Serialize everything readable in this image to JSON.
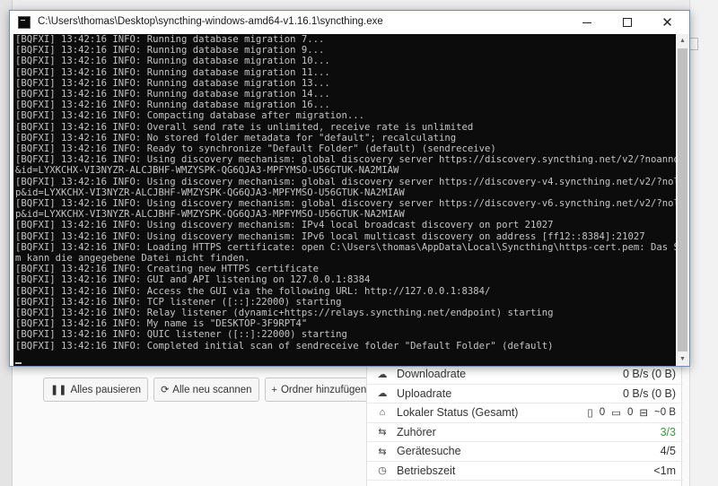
{
  "window": {
    "title": "C:\\Users\\thomas\\Desktop\\syncthing-windows-amd64-v1.16.1\\syncthing.exe",
    "controls": {
      "minimize": "—",
      "maximize": "☐",
      "close": "✕"
    }
  },
  "console": {
    "lines": [
      "[BQFXI] 13:42:16 INFO: Running database migration 7...",
      "[BQFXI] 13:42:16 INFO: Running database migration 9...",
      "[BQFXI] 13:42:16 INFO: Running database migration 10...",
      "[BQFXI] 13:42:16 INFO: Running database migration 11...",
      "[BQFXI] 13:42:16 INFO: Running database migration 13...",
      "[BQFXI] 13:42:16 INFO: Running database migration 14...",
      "[BQFXI] 13:42:16 INFO: Running database migration 16...",
      "[BQFXI] 13:42:16 INFO: Compacting database after migration...",
      "[BQFXI] 13:42:16 INFO: Overall send rate is unlimited, receive rate is unlimited",
      "[BQFXI] 13:42:16 INFO: No stored folder metadata for \"default\"; recalculating",
      "[BQFXI] 13:42:16 INFO: Ready to synchronize \"Default Folder\" (default) (sendreceive)",
      "[BQFXI] 13:42:16 INFO: Using discovery mechanism: global discovery server https://discovery.syncthing.net/v2/?noannounce",
      "&id=LYXKCHX-VI3NYZR-ALCJBHF-WMZYSPK-QG6QJA3-MPFYMSO-U56GTUK-NA2MIAW",
      "[BQFXI] 13:42:16 INFO: Using discovery mechanism: global discovery server https://discovery-v4.syncthing.net/v2/?nolooku",
      "p&id=LYXKCHX-VI3NYZR-ALCJBHF-WMZYSPK-QG6QJA3-MPFYMSO-U56GTUK-NA2MIAW",
      "[BQFXI] 13:42:16 INFO: Using discovery mechanism: global discovery server https://discovery-v6.syncthing.net/v2/?nolooku",
      "p&id=LYXKCHX-VI3NYZR-ALCJBHF-WMZYSPK-QG6QJA3-MPFYMSO-U56GTUK-NA2MIAW",
      "[BQFXI] 13:42:16 INFO: Using discovery mechanism: IPv4 local broadcast discovery on port 21027",
      "[BQFXI] 13:42:16 INFO: Using discovery mechanism: IPv6 local multicast discovery on address [ff12::8384]:21027",
      "[BQFXI] 13:42:16 INFO: Loading HTTPS certificate: open C:\\Users\\thomas\\AppData\\Local\\Syncthing\\https-cert.pem: Das Syste",
      "m kann die angegebene Datei nicht finden.",
      "[BQFXI] 13:42:16 INFO: Creating new HTTPS certificate",
      "[BQFXI] 13:42:16 INFO: GUI and API listening on 127.0.0.1:8384",
      "[BQFXI] 13:42:16 INFO: Access the GUI via the following URL: http://127.0.0.1:8384/",
      "[BQFXI] 13:42:16 INFO: TCP listener ([::]:22000) starting",
      "[BQFXI] 13:42:16 INFO: Relay listener (dynamic+https://relays.syncthing.net/endpoint) starting",
      "[BQFXI] 13:42:16 INFO: My name is \"DESKTOP-3F9RPT4\"",
      "[BQFXI] 13:42:16 INFO: QUIC listener ([::]:22000) starting",
      "[BQFXI] 13:42:16 INFO: Completed initial scan of sendreceive folder \"Default Folder\" (default)"
    ]
  },
  "folder_actions": {
    "pause_all": "Alles pausieren",
    "rescan_all": "Alle neu scannen",
    "add_folder": "Ordner hinzufügen"
  },
  "status_panel": {
    "download_label": "Downloadrate",
    "download_value": "0 B/s (0 B)",
    "upload_label": "Uploadrate",
    "upload_value": "0 B/s (0 B)",
    "local_state_label": "Lokaler Status (Gesamt)",
    "local_files": "0",
    "local_dirs": "0",
    "local_size": "~0 B",
    "listeners_label": "Zuhörer",
    "listeners_value": "3/3",
    "discovery_label": "Gerätesuche",
    "discovery_value": "4/5",
    "uptime_label": "Betriebszeit",
    "uptime_value": "<1m"
  },
  "icons": {
    "download": "cloud-download-icon",
    "upload": "cloud-upload-icon",
    "home": "home-icon",
    "listeners": "sitemap-icon",
    "discovery": "sitemap-icon",
    "uptime": "clock-icon"
  },
  "colors": {
    "terminal_bg": "#0c0c0c",
    "terminal_text": "#c4c4c4",
    "ok_green": "#3a9b3a",
    "window_border": "#6d8fb5"
  }
}
